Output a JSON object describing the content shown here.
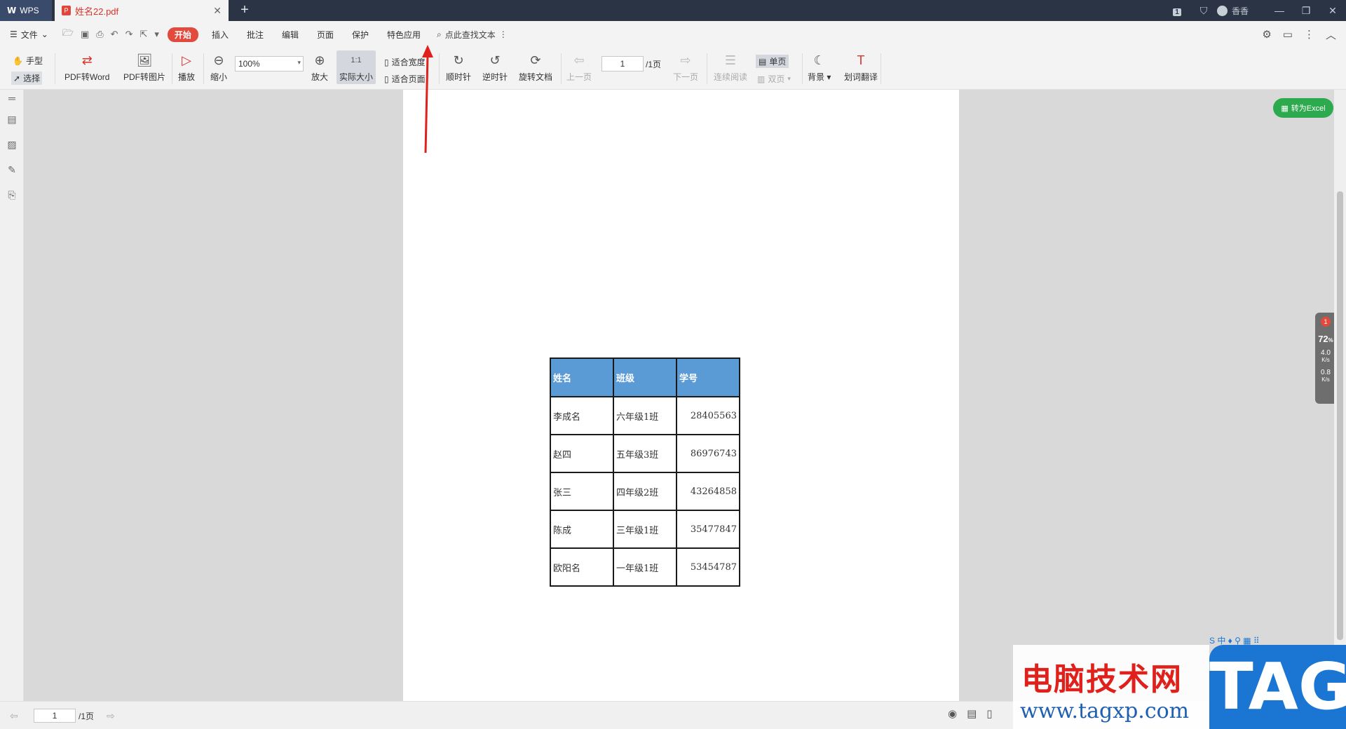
{
  "titlebar": {
    "app_name": "WPS",
    "doc_tab_title": "姓名22.pdf",
    "new_tab": "+",
    "badge": "1",
    "user_name": "香香"
  },
  "menubar": {
    "file_label": "文件",
    "tabs": [
      "开始",
      "插入",
      "批注",
      "编辑",
      "页面",
      "保护",
      "特色应用"
    ],
    "active_tab": "开始",
    "search_text": "点此查找文本"
  },
  "toolbar": {
    "hand": "手型",
    "select": "选择",
    "pdf_to_word": "PDF转Word",
    "pdf_to_image": "PDF转图片",
    "play": "播放",
    "zoom_out": "缩小",
    "zoom_value": "100%",
    "zoom_in": "放大",
    "actual_size": "实际大小",
    "fit_width": "适合宽度",
    "fit_page": "适合页面",
    "clockwise": "顺时针",
    "counterclockwise": "逆时针",
    "rotate_doc": "旋转文档",
    "prev_page": "上一页",
    "page_value": "1",
    "page_total": "/1页",
    "next_page": "下一页",
    "continuous": "连续阅读",
    "single_page": "单页",
    "double_page": "双页",
    "background": "背景",
    "translate": "划词翻译"
  },
  "document": {
    "table": {
      "headers": [
        "姓名",
        "班级",
        "学号"
      ],
      "rows": [
        [
          "李成名",
          "六年级1班",
          "28405563"
        ],
        [
          "赵四",
          "五年级3班",
          "86976743"
        ],
        [
          "张三",
          "四年级2班",
          "43264858"
        ],
        [
          "陈成",
          "三年级1班",
          "35477847"
        ],
        [
          "欧阳名",
          "一年级1班",
          "53454787"
        ]
      ]
    }
  },
  "side_widgets": {
    "to_excel": "转为Excel",
    "speed_badge": "1",
    "speed_percent": "72",
    "percent_sign": "%",
    "up_speed": "4.0",
    "down_speed": "0.8",
    "unit": "K/s"
  },
  "statusbar": {
    "page_value": "1",
    "page_total": "/1页"
  },
  "watermark": {
    "title": "电脑技术网",
    "url": "www.tagxp.com",
    "tag": "TAG"
  },
  "colors": {
    "accent_red": "#e34a3e",
    "table_header": "#5b9bd5",
    "excel_green": "#2eaa4e",
    "arrow_red": "#e0201b"
  }
}
